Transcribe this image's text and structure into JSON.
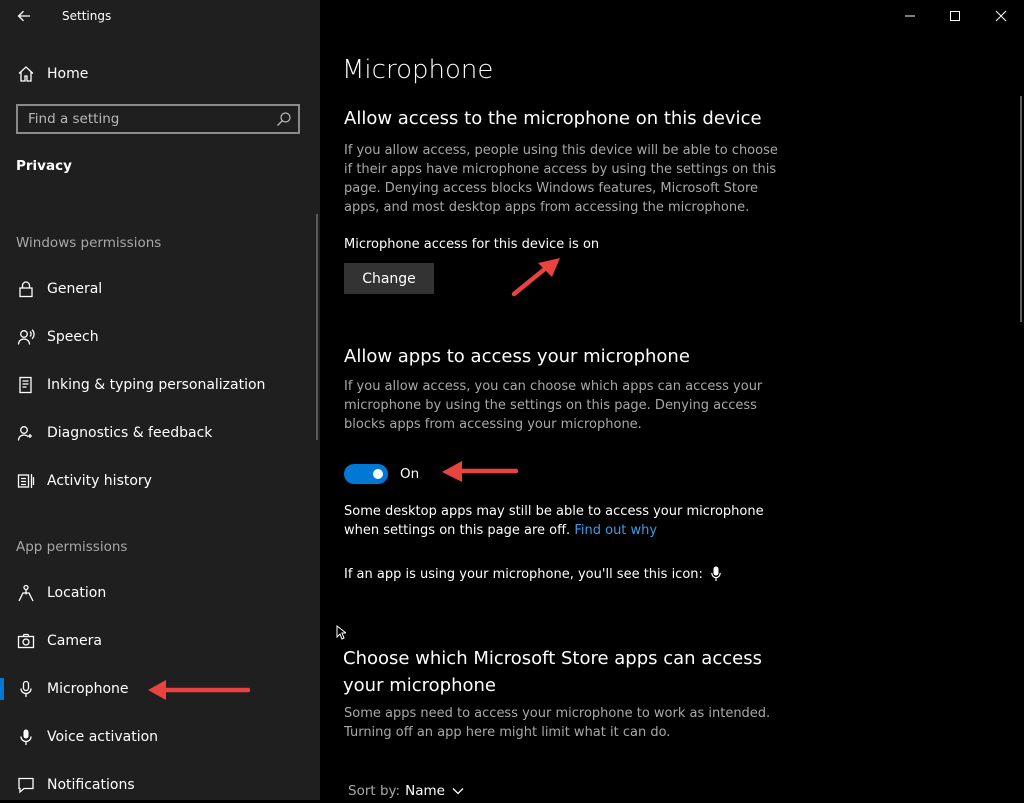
{
  "window": {
    "app_title": "Settings",
    "controls": [
      "minimize-icon",
      "maximize-icon",
      "close-icon"
    ]
  },
  "sidebar": {
    "home_label": "Home",
    "search_placeholder": "Find a setting",
    "breadcrumb": "Privacy",
    "sections": [
      {
        "heading": "Windows permissions",
        "items": [
          {
            "label": "General",
            "icon": "lock-icon"
          },
          {
            "label": "Speech",
            "icon": "speech-icon"
          },
          {
            "label": "Inking & typing personalization",
            "icon": "inking-icon"
          },
          {
            "label": "Diagnostics & feedback",
            "icon": "diagnostics-icon"
          },
          {
            "label": "Activity history",
            "icon": "activity-history-icon"
          }
        ]
      },
      {
        "heading": "App permissions",
        "items": [
          {
            "label": "Location",
            "icon": "location-icon"
          },
          {
            "label": "Camera",
            "icon": "camera-icon"
          },
          {
            "label": "Microphone",
            "icon": "microphone-icon",
            "selected": true
          },
          {
            "label": "Voice activation",
            "icon": "voice-activation-icon"
          },
          {
            "label": "Notifications",
            "icon": "notifications-icon"
          }
        ]
      }
    ]
  },
  "main": {
    "page_title": "Microphone",
    "device_access": {
      "heading": "Allow access to the microphone on this device",
      "description": "If you allow access, people using this device will be able to choose if their apps have microphone access by using the settings on this page. Denying access blocks Windows features, Microsoft Store apps, and most desktop apps from accessing the microphone.",
      "status": "Microphone access for this device is on",
      "change_button": "Change"
    },
    "app_access": {
      "heading": "Allow apps to access your microphone",
      "description": "If you allow access, you can choose which apps can access your microphone by using the settings on this page. Denying access blocks apps from accessing your microphone.",
      "toggle_state": "On",
      "note": "Some desktop apps may still be able to access your microphone when settings on this page are off.",
      "note_link": "Find out why",
      "icon_note": "If an app is using your microphone, you'll see this icon:"
    },
    "store_apps": {
      "heading": "Choose which Microsoft Store apps can access your microphone",
      "description": "Some apps need to access your microphone to work as intended. Turning off an app here might limit what it can do.",
      "sort_label": "Sort by:",
      "sort_value": "Name"
    }
  },
  "colors": {
    "accent": "#0078d4",
    "link": "#3a9be5",
    "annotation_arrow": "#e8433f",
    "sidebar_bg": "#1f1f1f",
    "main_bg": "#000000"
  }
}
